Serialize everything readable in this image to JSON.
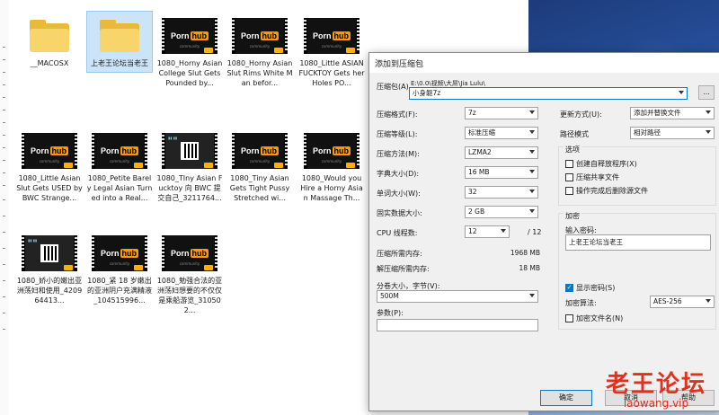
{
  "files": [
    {
      "name": "__MACOSX",
      "type": "folder"
    },
    {
      "name": "上老王论坛当老王",
      "type": "folder",
      "selected": true
    },
    {
      "name": "1080_Horny Asian College Slut Gets Pounded by...",
      "type": "video"
    },
    {
      "name": "1080_Horny Asian Slut Rims White Man befor...",
      "type": "video"
    },
    {
      "name": "1080_Little ASIAN FUCKTOY Gets her Holes PO...",
      "type": "video"
    },
    {
      "name": "1080_Little Asian Slut Gets USED by BWC Strange...",
      "type": "video"
    },
    {
      "name": "1080_Petite Barely Legal Asian Turned into a Real...",
      "type": "video"
    },
    {
      "name": "1080_TIny Asian Fucktoy 向 BWC 提交自己_3211764...",
      "type": "qr"
    },
    {
      "name": "1080_Tiny Asian Gets Tight Pussy Stretched wi...",
      "type": "video"
    },
    {
      "name": "1080_Would you Hire a Horny Asian Massage Th...",
      "type": "video"
    },
    {
      "name": "1080_娇小的嫩出亚洲荡妇和使用_420964413...",
      "type": "qr"
    },
    {
      "name": "1080_紧 18 岁嫩出的亚洲阴户充满精液_104515996...",
      "type": "video"
    },
    {
      "name": "1080_勉强合法的亚洲荡妇想要的不仅仅是乘船游览_310502...",
      "type": "video"
    }
  ],
  "thumb": {
    "logo_a": "Porn",
    "logo_b": "hub",
    "logo_sub": "community"
  },
  "dialog": {
    "title": "添加到压缩包",
    "archive_label": "压缩包(A)",
    "archive_path": "E:\\0.0\\视频\\大屌\\Jia Lulu\\",
    "archive_name": "小身躯7z",
    "browse_button": "...",
    "format_label": "压缩格式(F):",
    "format_value": "7z",
    "level_label": "压缩等级(L):",
    "level_value": "标准压缩",
    "method_label": "压缩方法(M):",
    "method_value": "LZMA2",
    "dict_label": "字典大小(D):",
    "dict_value": "16 MB",
    "word_label": "单词大小(W):",
    "word_value": "32",
    "solid_label": "固实数据大小:",
    "solid_value": "2 GB",
    "cpu_label": "CPU 线程数:",
    "cpu_value": "12",
    "cpu_max": "/ 12",
    "mem_comp_label": "压缩所需内存:",
    "mem_comp_value": "1968 MB",
    "mem_decomp_label": "解压缩所需内存:",
    "mem_decomp_value": "18 MB",
    "split_label": "分卷大小，字节(V):",
    "split_value": "500M",
    "params_label": "参数(P):",
    "update_label": "更新方式(U):",
    "update_value": "添加并替换文件",
    "path_label": "路径模式",
    "path_value": "相对路径",
    "options_title": "选项",
    "opt_sfx": "创建自释放程序(X)",
    "opt_shared": "压缩共享文件",
    "opt_delete": "操作完成后删除源文件",
    "encryption_title": "加密",
    "password_label": "输入密码:",
    "password_value": "上老王论坛当老王",
    "show_password": "显示密码(S)",
    "enc_method_label": "加密算法:",
    "enc_method_value": "AES-256",
    "encrypt_names": "加密文件名(N)",
    "ok": "确定",
    "cancel": "取消",
    "help": "帮助"
  },
  "watermark": {
    "line1": "老王论坛",
    "line2": "laowang.vip"
  }
}
